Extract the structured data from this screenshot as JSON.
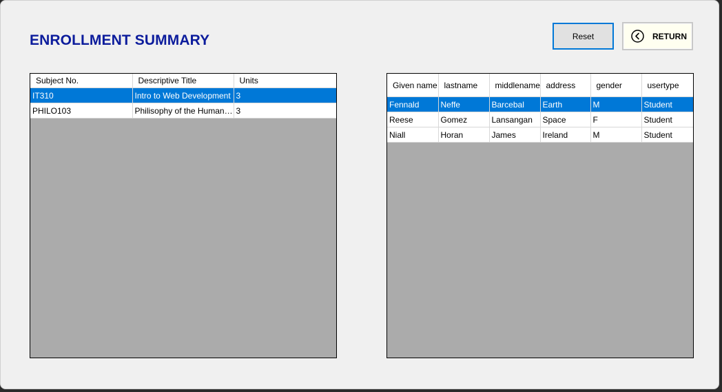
{
  "window": {
    "title": "ENROLLMENT SUMMARY",
    "reset_label": "Reset",
    "return_label": "RETURN",
    "return_icon": "chevron-left-circle-icon"
  },
  "subjects": {
    "columns": [
      "Subject No.",
      "Descriptive Title",
      "Units"
    ],
    "rows": [
      {
        "subject_no": "IT310",
        "title": "Intro to Web Development",
        "units": "3",
        "selected": true
      },
      {
        "subject_no": "PHILO103",
        "title": "Philisophy of the Human Pe...",
        "units": "3",
        "selected": false
      }
    ]
  },
  "users": {
    "columns": [
      "Given name",
      "lastname",
      "middlename",
      "address",
      "gender",
      "usertype"
    ],
    "rows": [
      {
        "given": "Fennald",
        "last": "Neffe",
        "middle": "Barcebal",
        "address": "Earth",
        "gender": "M",
        "usertype": "Student",
        "selected": true
      },
      {
        "given": "Reese",
        "last": "Gomez",
        "middle": "Lansangan",
        "address": "Space",
        "gender": "F",
        "usertype": "Student",
        "selected": false
      },
      {
        "given": "Niall",
        "last": "Horan",
        "middle": "James",
        "address": "Ireland",
        "gender": "M",
        "usertype": "Student",
        "selected": false
      }
    ]
  },
  "colors": {
    "title": "#0c1c9c",
    "selection": "#0078d7",
    "grid_background": "#ababab"
  }
}
